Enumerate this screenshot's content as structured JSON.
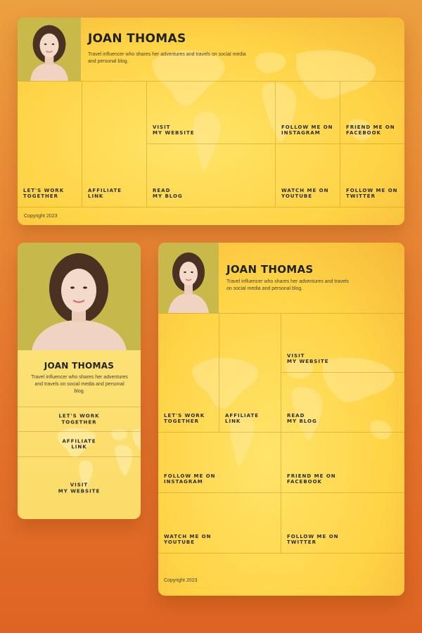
{
  "colors": {
    "background_top": "#eda040",
    "background_bottom": "#df6424",
    "card_yellow": "#ffd84a",
    "card_pale": "#fde27c",
    "text_dark": "#1f2226"
  },
  "profile": {
    "name": "JOAN THOMAS",
    "bio": "Travel influencer who shares her adventures and travels on social media and personal blog.",
    "photo_icon": "profile-photo"
  },
  "links": {
    "work": "LET'S WORK\nTOGETHER",
    "affiliate": "AFFILIATE\nLINK",
    "website": "VISIT\nMY WEBSITE",
    "blog": "READ\nMY BLOG",
    "instagram": "FOLLOW ME ON\nINSTAGRAM",
    "facebook": "FRIEND ME ON\nFACEBOOK",
    "youtube": "WATCH ME ON\nYOUTUBE",
    "twitter": "FOLLOW ME ON\nTWITTER"
  },
  "footer": {
    "copyright": "Copyright 2023"
  }
}
